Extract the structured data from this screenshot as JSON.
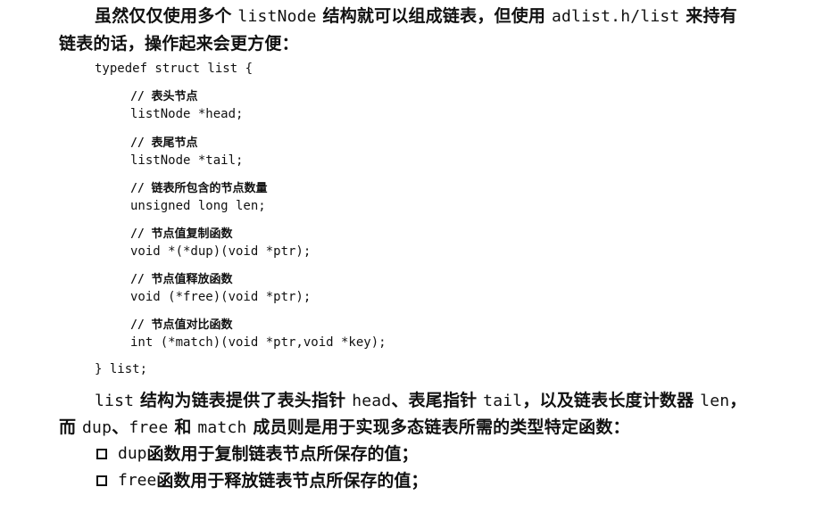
{
  "intro": {
    "line1": [
      {
        "t": "虽然仅仅使用多个 ",
        "mono": false
      },
      {
        "t": "listNode",
        "mono": true
      },
      {
        "t": " 结构就可以组成链表，但使用 ",
        "mono": false
      },
      {
        "t": "adlist.h/list",
        "mono": true
      },
      {
        "t": " 来持有",
        "mono": false
      }
    ],
    "line2": "链表的话，操作起来会更方便："
  },
  "code": {
    "open": "typedef struct list {",
    "fields": [
      {
        "comment": "// 表头节点",
        "decl": "listNode *head;"
      },
      {
        "comment": "// 表尾节点",
        "decl": "listNode *tail;"
      },
      {
        "comment": "// 链表所包含的节点数量",
        "decl": "unsigned long len;"
      },
      {
        "comment": "// 节点值复制函数",
        "decl": "void *(*dup)(void *ptr);"
      },
      {
        "comment": "// 节点值释放函数",
        "decl": "void (*free)(void *ptr);"
      },
      {
        "comment": "// 节点值对比函数",
        "decl": "int (*match)(void *ptr,void *key);"
      }
    ],
    "close": "} list;"
  },
  "desc": {
    "line1": [
      {
        "t": "list",
        "mono": true
      },
      {
        "t": " 结构为链表提供了表头指针 ",
        "mono": false
      },
      {
        "t": "head",
        "mono": true
      },
      {
        "t": "、表尾指针 ",
        "mono": false
      },
      {
        "t": "tail",
        "mono": true
      },
      {
        "t": "，以及链表长度计数器 ",
        "mono": false
      },
      {
        "t": "len",
        "mono": true
      },
      {
        "t": "，",
        "mono": false
      }
    ],
    "line2": [
      {
        "t": "而 ",
        "mono": false
      },
      {
        "t": "dup",
        "mono": true
      },
      {
        "t": "、",
        "mono": false
      },
      {
        "t": "free",
        "mono": true
      },
      {
        "t": " 和 ",
        "mono": false
      },
      {
        "t": "match",
        "mono": true
      },
      {
        "t": " 成员则是用于实现多态链表所需的类型特定函数：",
        "mono": false
      }
    ]
  },
  "bullets": [
    {
      "code": "dup",
      "text": " 函数用于复制链表节点所保存的值；"
    },
    {
      "code": "free",
      "text": " 函数用于释放链表节点所保存的值；"
    }
  ]
}
